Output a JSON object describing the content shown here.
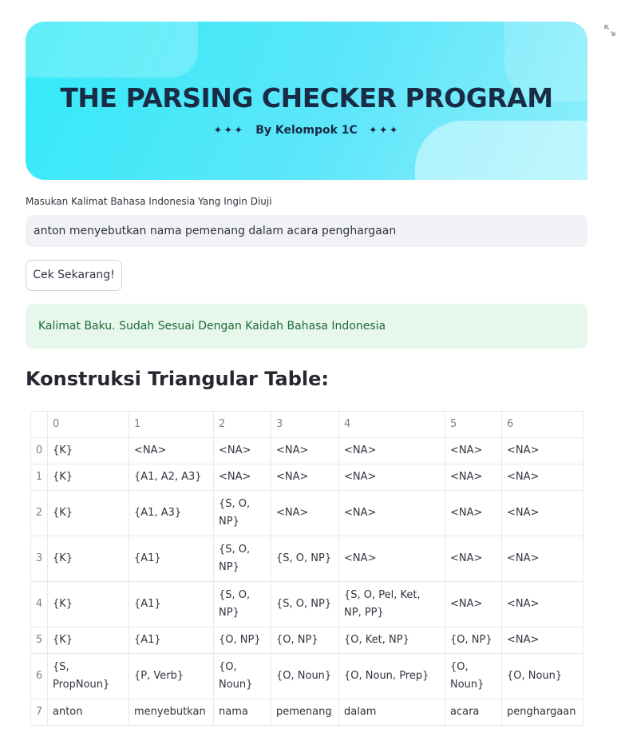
{
  "banner": {
    "title": "THE PARSING CHECKER  PROGRAM",
    "stars_left": "✦✦✦",
    "subtitle": "By Kelompok 1C",
    "stars_right": "✦✦✦"
  },
  "input": {
    "label": "Masukan Kalimat Bahasa Indonesia Yang Ingin Diuji",
    "value": "anton menyebutkan nama pemenang dalam acara penghargaan"
  },
  "button": {
    "label": "Cek Sekarang!"
  },
  "alert": {
    "text": "Kalimat Baku. Sudah Sesuai Dengan Kaidah Bahasa Indonesia",
    "color": "#1d6b35"
  },
  "heading": "Konstruksi Triangular Table:",
  "icons": {
    "expand": "expand-icon"
  },
  "table": {
    "columns": [
      "",
      "0",
      "1",
      "2",
      "3",
      "4",
      "5",
      "6"
    ],
    "rows": [
      {
        "index": "0",
        "cells": [
          "{K}",
          "<NA>",
          "<NA>",
          "<NA>",
          "<NA>",
          "<NA>",
          "<NA>"
        ]
      },
      {
        "index": "1",
        "cells": [
          "{K}",
          "{A1, A2, A3}",
          "<NA>",
          "<NA>",
          "<NA>",
          "<NA>",
          "<NA>"
        ]
      },
      {
        "index": "2",
        "cells": [
          "{K}",
          "{A1, A3}",
          "{S, O, NP}",
          "<NA>",
          "<NA>",
          "<NA>",
          "<NA>"
        ]
      },
      {
        "index": "3",
        "cells": [
          "{K}",
          "{A1}",
          "{S, O, NP}",
          "{S, O, NP}",
          "<NA>",
          "<NA>",
          "<NA>"
        ]
      },
      {
        "index": "4",
        "cells": [
          "{K}",
          "{A1}",
          "{S, O, NP}",
          "{S, O, NP}",
          "{S, O, Pel, Ket, NP, PP}",
          "<NA>",
          "<NA>"
        ]
      },
      {
        "index": "5",
        "cells": [
          "{K}",
          "{A1}",
          "{O, NP}",
          "{O, NP}",
          "{O, Ket, NP}",
          "{O, NP}",
          "<NA>"
        ]
      },
      {
        "index": "6",
        "cells": [
          "{S, PropNoun}",
          "{P, Verb}",
          "{O, Noun}",
          "{O, Noun}",
          "{O, Noun, Prep}",
          "{O, Noun}",
          "{O, Noun}"
        ]
      },
      {
        "index": "7",
        "cells": [
          "anton",
          "menyebutkan",
          "nama",
          "pemenang",
          "dalam",
          "acara",
          "penghargaan"
        ]
      }
    ]
  }
}
